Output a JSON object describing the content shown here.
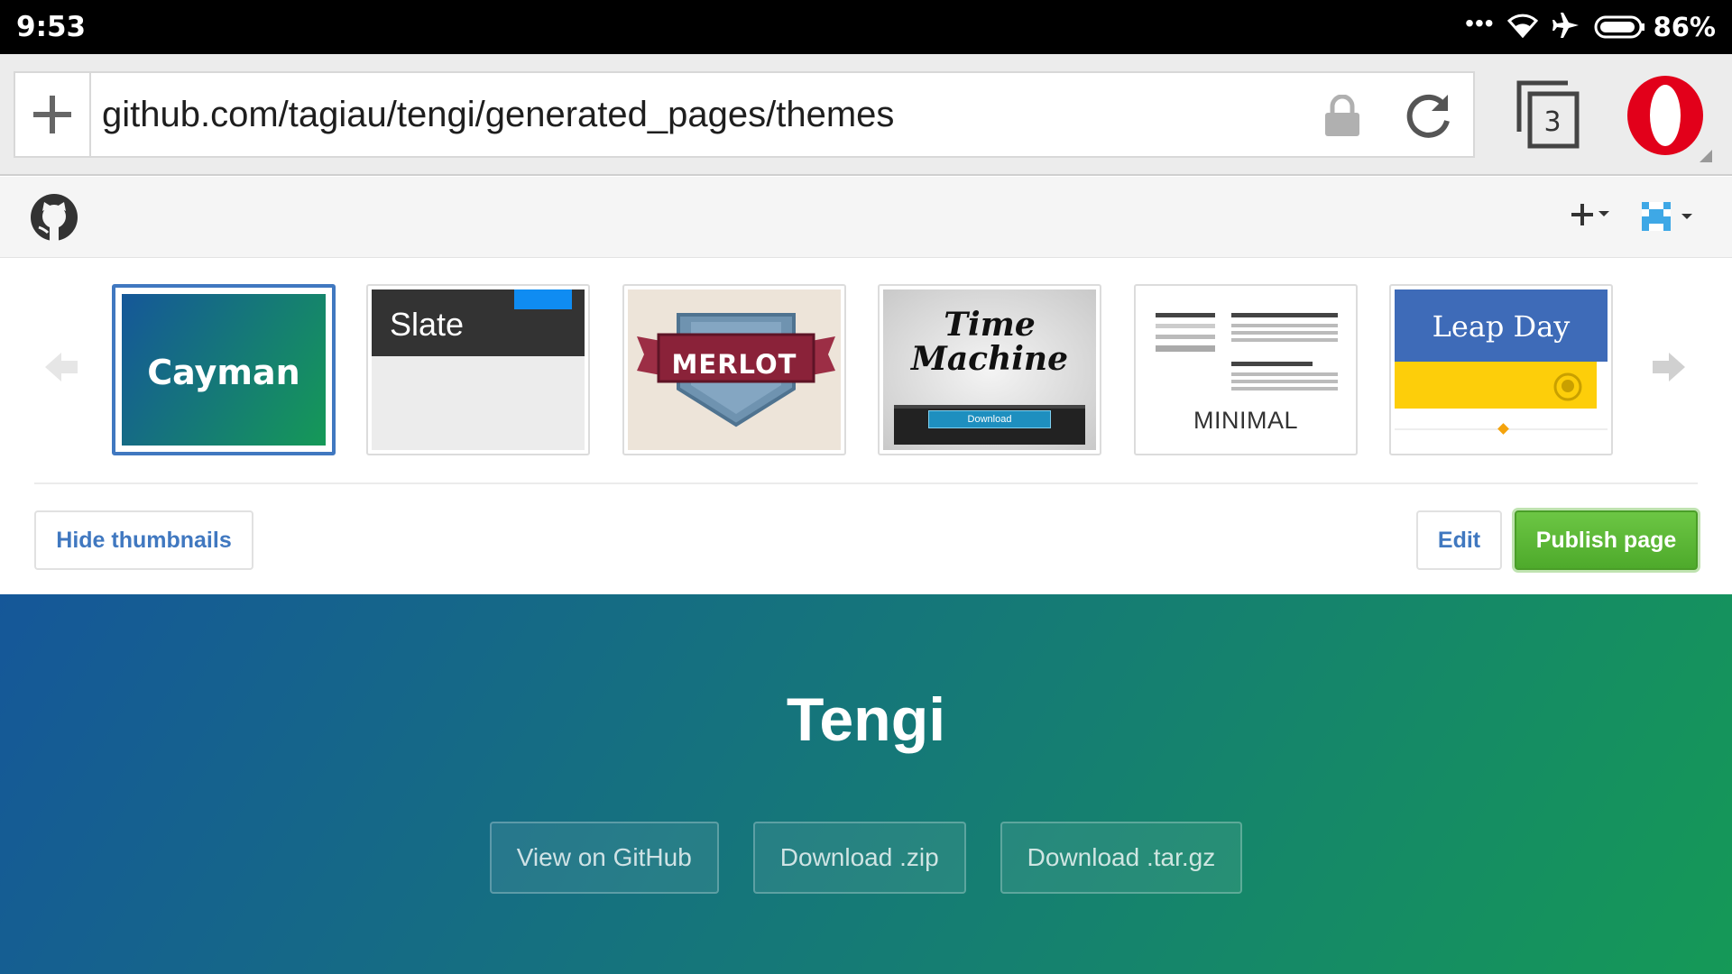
{
  "status_bar": {
    "time": "9:53",
    "dots": "•••",
    "battery_percent": "86%",
    "icons": [
      "more-dots-icon",
      "wifi-icon",
      "airplane-icon",
      "battery-icon"
    ]
  },
  "browser": {
    "url": "github.com/tagiau/tengi/generated_pages/themes",
    "tab_count": "3",
    "icons": [
      "plus-icon",
      "lock-icon",
      "reload-icon",
      "tabs-icon",
      "opera-menu-icon"
    ]
  },
  "github_header": {
    "icons": [
      "github-logo-icon",
      "plus-dropdown-icon",
      "avatar-dropdown-icon"
    ]
  },
  "themes": {
    "selected": "Cayman",
    "items": [
      {
        "name": "Cayman"
      },
      {
        "name": "Slate"
      },
      {
        "name": "MERLOT"
      },
      {
        "name": "Time Machine",
        "button": "Download"
      },
      {
        "name": "MINIMAL"
      },
      {
        "name": "Leap Day"
      }
    ],
    "hide_thumbnails_label": "Hide thumbnails",
    "edit_label": "Edit",
    "publish_label": "Publish page"
  },
  "preview": {
    "title": "Tengi",
    "buttons": [
      "View on GitHub",
      "Download .zip",
      "Download .tar.gz"
    ]
  },
  "colors": {
    "cayman_start": "#155799",
    "cayman_end": "#159957",
    "github_link": "#4078c0",
    "publish_green": "#6cc644",
    "opera_red": "#e2001a"
  }
}
